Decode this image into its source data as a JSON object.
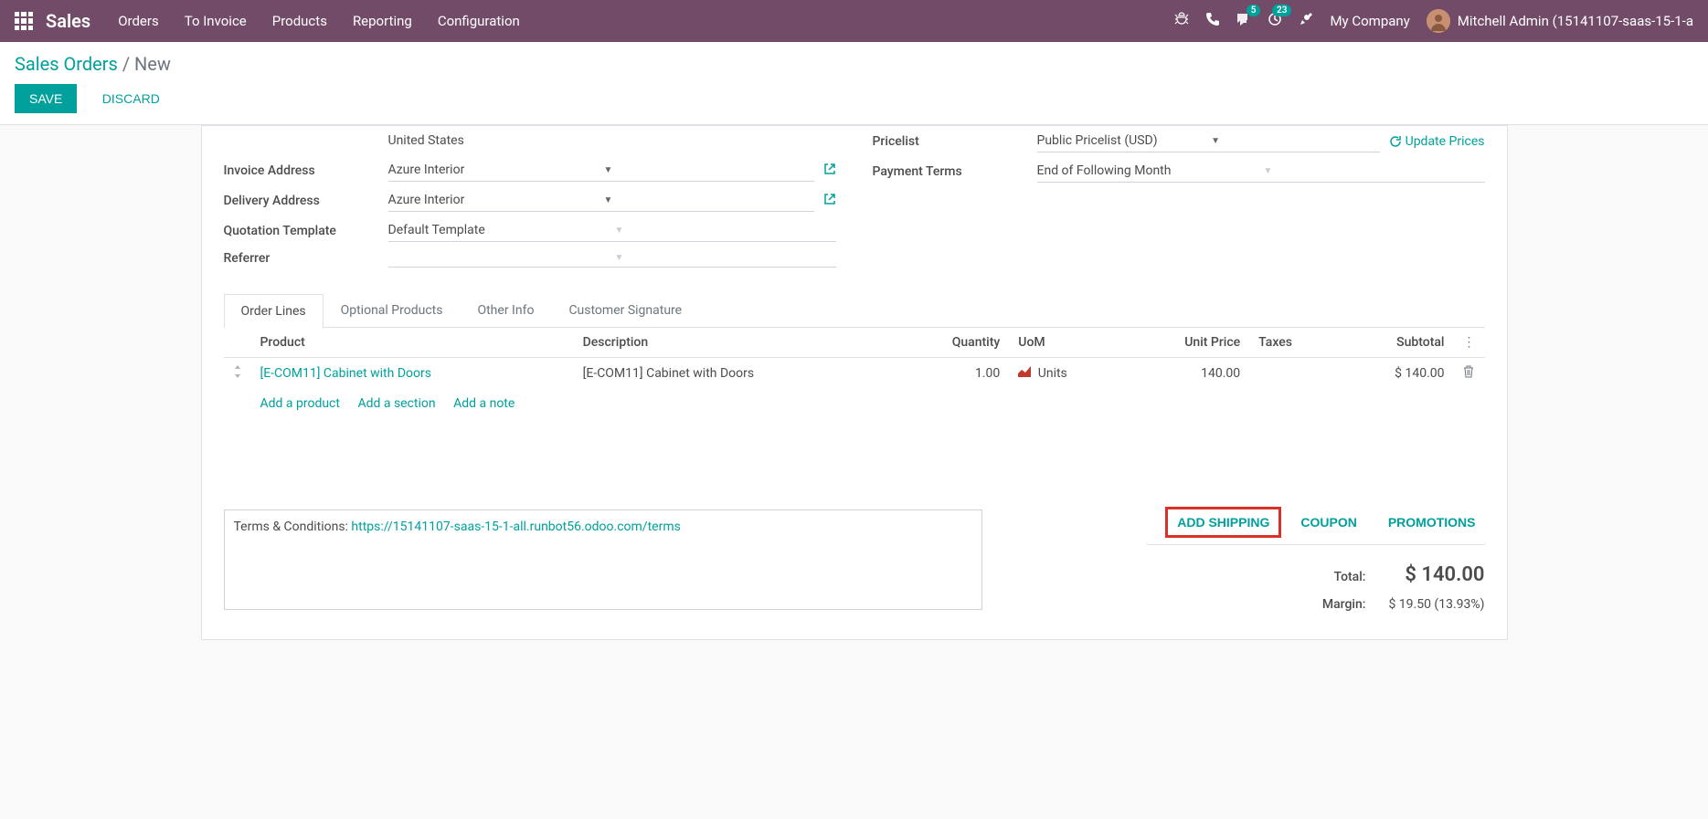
{
  "nav": {
    "brand": "Sales",
    "menu": [
      "Orders",
      "To Invoice",
      "Products",
      "Reporting",
      "Configuration"
    ],
    "messaging_badge": "5",
    "activities_badge": "23",
    "company": "My Company",
    "user": "Mitchell Admin (15141107-saas-15-1-a"
  },
  "breadcrumb": {
    "root": "Sales Orders",
    "current": "New"
  },
  "buttons": {
    "save": "SAVE",
    "discard": "DISCARD"
  },
  "form": {
    "country": "United States",
    "invoice_address_label": "Invoice Address",
    "invoice_address": "Azure Interior",
    "delivery_address_label": "Delivery Address",
    "delivery_address": "Azure Interior",
    "quotation_template_label": "Quotation Template",
    "quotation_template": "Default Template",
    "referrer_label": "Referrer",
    "referrer": "",
    "pricelist_label": "Pricelist",
    "pricelist": "Public Pricelist (USD)",
    "update_prices": "Update Prices",
    "payment_terms_label": "Payment Terms",
    "payment_terms": "End of Following Month"
  },
  "tabs": [
    "Order Lines",
    "Optional Products",
    "Other Info",
    "Customer Signature"
  ],
  "columns": {
    "product": "Product",
    "description": "Description",
    "quantity": "Quantity",
    "uom": "UoM",
    "unit_price": "Unit Price",
    "taxes": "Taxes",
    "subtotal": "Subtotal"
  },
  "lines": [
    {
      "product": "[E-COM11] Cabinet with Doors",
      "description": "[E-COM11] Cabinet with Doors",
      "quantity": "1.00",
      "uom": "Units",
      "unit_price": "140.00",
      "taxes": "",
      "subtotal": "$ 140.00"
    }
  ],
  "add": {
    "product": "Add a product",
    "section": "Add a section",
    "note": "Add a note"
  },
  "terms": {
    "prefix": "Terms & Conditions: ",
    "link": "https://15141107-saas-15-1-all.runbot56.odoo.com/terms"
  },
  "actions": {
    "add_shipping": "ADD SHIPPING",
    "coupon": "COUPON",
    "promotions": "PROMOTIONS"
  },
  "totals": {
    "total_label": "Total:",
    "total": "$ 140.00",
    "margin_label": "Margin:",
    "margin": "$ 19.50 (13.93%)"
  }
}
